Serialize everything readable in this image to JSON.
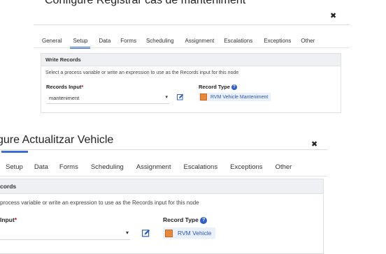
{
  "dialog1": {
    "title": "Configure Registrar cas de manteniment",
    "close_symbol": "✖",
    "tabs": [
      "General",
      "Setup",
      "Data",
      "Forms",
      "Scheduling",
      "Assignment",
      "Escalations",
      "Exceptions",
      "Other"
    ],
    "active_tab": "Setup",
    "section_title": "Write Records",
    "section_desc": "Select a process variable or write an expression to use as the Records input for this node",
    "records_input_label": "Records Input",
    "required_mark": "*",
    "records_input_value": "manteniment",
    "record_type_label": "Record Type",
    "record_type_value": "RVM Vehicle Manteniment"
  },
  "dialog2": {
    "title": "gure Actualitzar Vehicle",
    "close_symbol": "✖",
    "tabs": [
      "Setup",
      "Data",
      "Forms",
      "Scheduling",
      "Assignment",
      "Escalations",
      "Exceptions",
      "Other"
    ],
    "active_tab": "Setup",
    "section_title": "cords",
    "section_desc": "process variable or write an expression to use as the Records input for this node",
    "records_input_label": "Input",
    "required_mark": "*",
    "record_type_label": "Record Type",
    "record_type_value": "RVM Vehicle"
  },
  "colors": {
    "accent": "#3b6fd6",
    "chip_bg": "#eaf1fb",
    "chip_text": "#2d55b7",
    "record_icon": "#e8893a",
    "required": "#d0021b"
  },
  "icons": {
    "close": "close-icon",
    "caret": "chevron-down-icon",
    "edit": "edit-icon",
    "help": "help-icon",
    "record": "record-type-icon"
  }
}
